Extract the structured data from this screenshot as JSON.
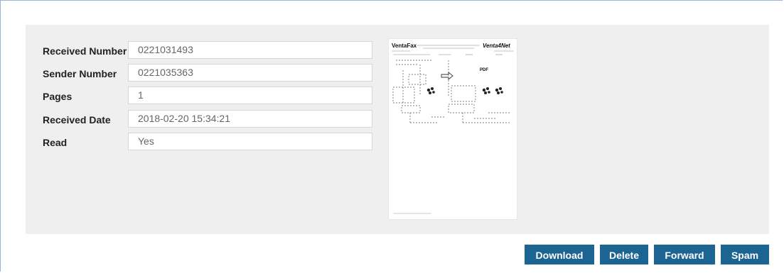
{
  "details": {
    "fields": [
      {
        "label": "Received Number",
        "value": "0221031493"
      },
      {
        "label": "Sender Number",
        "value": "0221035363"
      },
      {
        "label": "Pages",
        "value": "1"
      },
      {
        "label": "Received Date",
        "value": "2018-02-20 15:34:21"
      },
      {
        "label": "Read",
        "value": "Yes"
      }
    ]
  },
  "preview": {
    "brand_left": "VentaFax",
    "brand_right": "Venta4Net",
    "doc_label": "PDF"
  },
  "actions": {
    "download": "Download",
    "delete": "Delete",
    "forward": "Forward",
    "spam": "Spam"
  },
  "colors": {
    "button_bg": "#1c6592",
    "panel_bg": "#efefef"
  }
}
